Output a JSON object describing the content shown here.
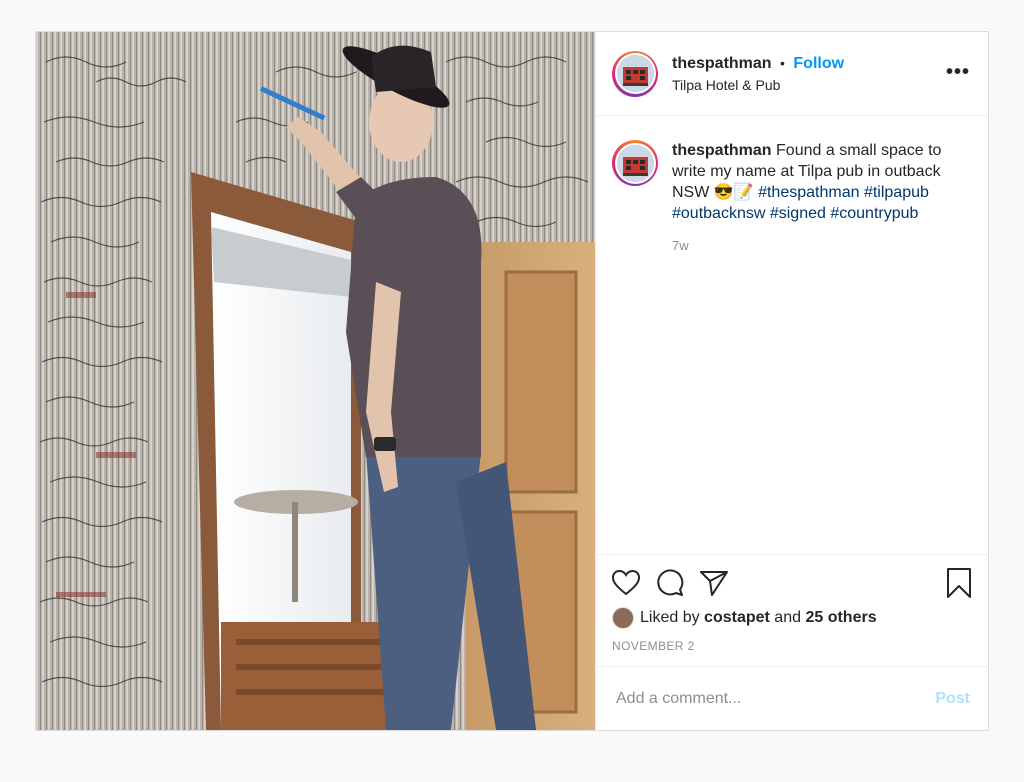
{
  "post": {
    "username": "thespathman",
    "separator": "•",
    "follow_label": "Follow",
    "location": "Tilpa Hotel & Pub",
    "more_label": "•••"
  },
  "caption": {
    "username": "thespathman",
    "text": "Found a small space to write my name at Tilpa pub in outback NSW",
    "emoji": "😎📝",
    "hashtags": [
      "#thespathman",
      "#tilpapub",
      "#outbacknsw",
      "#signed",
      "#countrypub"
    ],
    "time": "7w"
  },
  "likes": {
    "prefix": "Liked by",
    "user": "costapet",
    "middle": "and",
    "others": "25 others"
  },
  "date": "NOVEMBER 2",
  "comment": {
    "placeholder": "Add a comment...",
    "post_label": "Post"
  },
  "icons": [
    "heart-icon",
    "comment-icon",
    "share-icon",
    "bookmark-icon",
    "more-icon"
  ],
  "colors": {
    "follow": "#0095f6",
    "hashtag": "#00376b",
    "post_disabled": "#b2dffc",
    "muted": "#8e8e8e"
  }
}
